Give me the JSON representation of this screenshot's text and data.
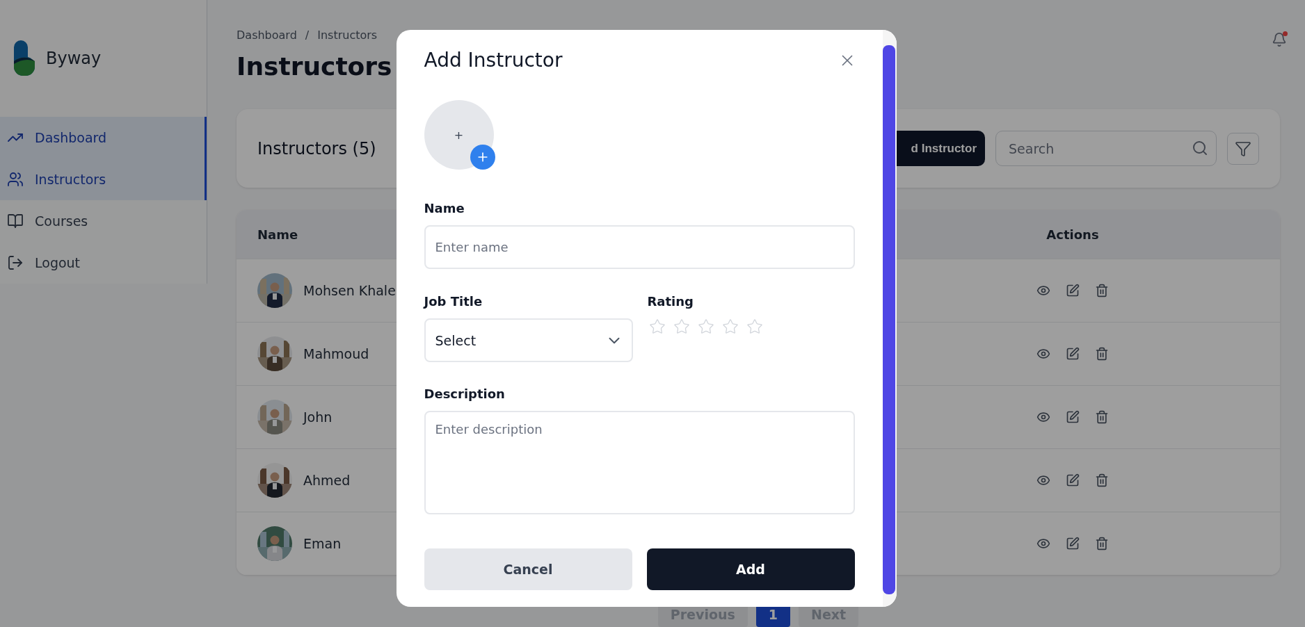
{
  "sidebar": {
    "brand": "Byway",
    "items": [
      {
        "label": "Dashboard",
        "selected": true
      },
      {
        "label": "Instructors",
        "selected": true
      },
      {
        "label": "Courses",
        "selected": false
      },
      {
        "label": "Logout",
        "selected": false
      }
    ]
  },
  "breadcrumb": {
    "items": [
      "Dashboard",
      "Instructors"
    ],
    "separator": "/"
  },
  "notifications": {
    "unread": true
  },
  "page_title": "Instructors",
  "toolbar": {
    "heading": "Instructors (5)",
    "add_button": "d Instructor",
    "search": {
      "placeholder": "Search"
    }
  },
  "table": {
    "columns": [
      {
        "label": "Name"
      },
      {
        "label": "Actions"
      }
    ],
    "rows": [
      {
        "name": "Mohsen Khale"
      },
      {
        "name": "Mahmoud"
      },
      {
        "name": "John"
      },
      {
        "name": "Ahmed"
      },
      {
        "name": "Eman"
      }
    ]
  },
  "pagination": {
    "previous": {
      "label": "Previous",
      "disabled": true
    },
    "pages": [
      {
        "label": "1",
        "selected": true
      }
    ],
    "next": {
      "label": "Next",
      "disabled": true
    }
  },
  "modal": {
    "title": "Add Instructor",
    "photo": {
      "symbol": "+"
    },
    "name": {
      "label": "Name",
      "placeholder": "Enter name"
    },
    "job_title": {
      "label": "Job Title",
      "value": "Select"
    },
    "rating": {
      "label": "Rating",
      "stars": 0
    },
    "description": {
      "label": "Description",
      "placeholder": "Enter description"
    },
    "buttons": [
      {
        "label": "Cancel",
        "kind": "secondary"
      },
      {
        "label": "Add",
        "kind": "primary"
      }
    ]
  }
}
